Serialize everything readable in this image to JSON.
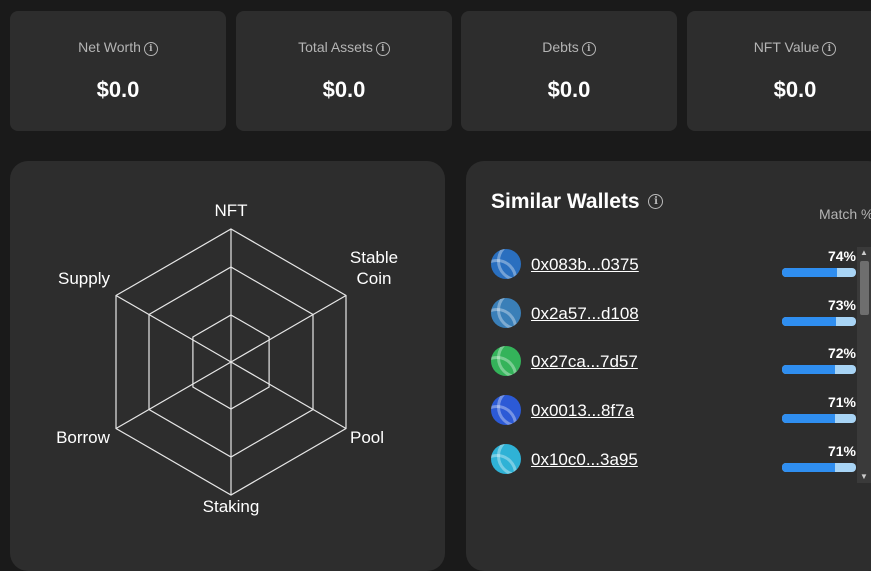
{
  "stats": [
    {
      "label": "Net Worth",
      "value": "$0.0"
    },
    {
      "label": "Total Assets",
      "value": "$0.0"
    },
    {
      "label": "Debts",
      "value": "$0.0"
    },
    {
      "label": "NFT Value",
      "value": "$0.0"
    }
  ],
  "radar": {
    "labels": {
      "nft": "NFT",
      "stable_line1": "Stable",
      "stable_line2": "Coin",
      "pool": "Pool",
      "staking": "Staking",
      "borrow": "Borrow",
      "supply": "Supply"
    }
  },
  "similar_wallets": {
    "title": "Similar Wallets",
    "match_header": "Match %",
    "wallets": [
      {
        "address": "0x083b...0375",
        "match": "74%",
        "match_value": 74,
        "color": "#2a6fbf"
      },
      {
        "address": "0x2a57...d108",
        "match": "73%",
        "match_value": 73,
        "color": "#3a7fb8"
      },
      {
        "address": "0x27ca...7d57",
        "match": "72%",
        "match_value": 72,
        "color": "#34b35a"
      },
      {
        "address": "0x0013...8f7a",
        "match": "71%",
        "match_value": 71,
        "color": "#2c5ad6"
      },
      {
        "address": "0x10c0...3a95",
        "match": "71%",
        "match_value": 71,
        "color": "#2fb2d6"
      }
    ]
  }
}
